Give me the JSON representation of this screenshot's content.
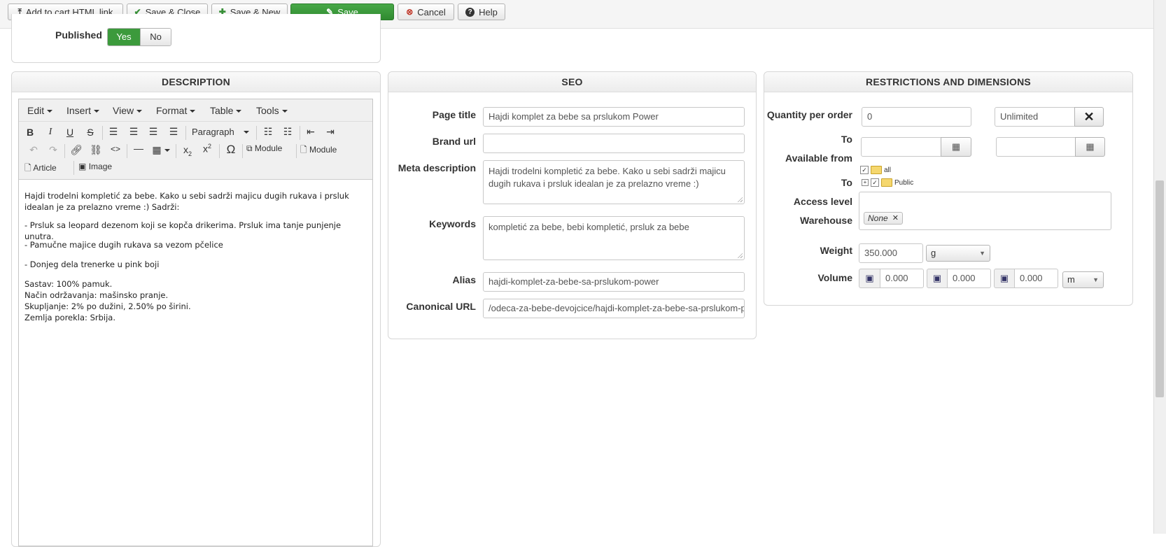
{
  "toolbar": {
    "add_to_cart": "Add to cart HTML link",
    "save_close": "Save & Close",
    "save_new": "Save & New",
    "save": "Save",
    "cancel": "Cancel",
    "help": "Help"
  },
  "published": {
    "label": "Published",
    "yes": "Yes",
    "no": "No",
    "selected": "Yes"
  },
  "description": {
    "title": "DESCRIPTION",
    "menu": [
      "Edit",
      "Insert",
      "View",
      "Format",
      "Table",
      "Tools"
    ],
    "format_select": "Paragraph",
    "module_1": "Module",
    "module_2": "Module",
    "article": "Article",
    "image": "Image",
    "content": [
      "Hajdi trodelni kompletić za bebe. Kako u sebi sadrži majicu dugih rukava i prsluk idealan je za prelazno vreme :) Sadrži:",
      "- Prsluk sa leopard dezenom koji se kopča drikerima. Prsluk ima tanje punjenje unutra.",
      "- Pamučne majice dugih rukava sa vezom pčelice",
      "- Donjeg dela trenerke u pink boji",
      "Sastav: 100% pamuk.",
      "Način održavanja: mašinsko pranje.",
      "Skupljanje: 2% po dužini, 2.50% po širini.",
      "Zemlja porekla: Srbija."
    ]
  },
  "seo": {
    "title": "SEO",
    "page_title_label": "Page title",
    "page_title": "Hajdi komplet za bebe sa prslukom Power",
    "brand_url_label": "Brand url",
    "brand_url": "",
    "meta_description_label": "Meta description",
    "meta_description": "Hajdi trodelni kompletić za bebe. Kako u sebi sadrži majicu dugih rukava i prsluk idealan je za prelazno vreme :)",
    "keywords_label": "Keywords",
    "keywords": "kompletić za bebe, bebi kompletić, prsluk za bebe",
    "alias_label": "Alias",
    "alias": "hajdi-komplet-za-bebe-sa-prslukom-power",
    "canonical_label": "Canonical URL",
    "canonical": "/odeca-za-bebe-devojcice/hajdi-komplet-za-bebe-sa-prslukom-power"
  },
  "restrictions": {
    "title": "RESTRICTIONS AND DIMENSIONS",
    "quantity_label": "Quantity per order",
    "quantity_min": "0",
    "quantity_max": "Unlimited",
    "to_label": "To",
    "available_from_label": "Available from",
    "to_label_2": "To",
    "tree_all": "all",
    "tree_public": "Public",
    "access_level_label": "Access level",
    "warehouse_label": "Warehouse",
    "warehouse_tag": "None",
    "weight_label": "Weight",
    "weight": "350.000",
    "weight_unit": "g",
    "volume_label": "Volume",
    "volume_1": "0.000",
    "volume_2": "0.000",
    "volume_3": "0.000",
    "volume_unit": "m"
  },
  "colors": {
    "accent_green": "#3c9a3c",
    "danger": "#c0392b"
  }
}
